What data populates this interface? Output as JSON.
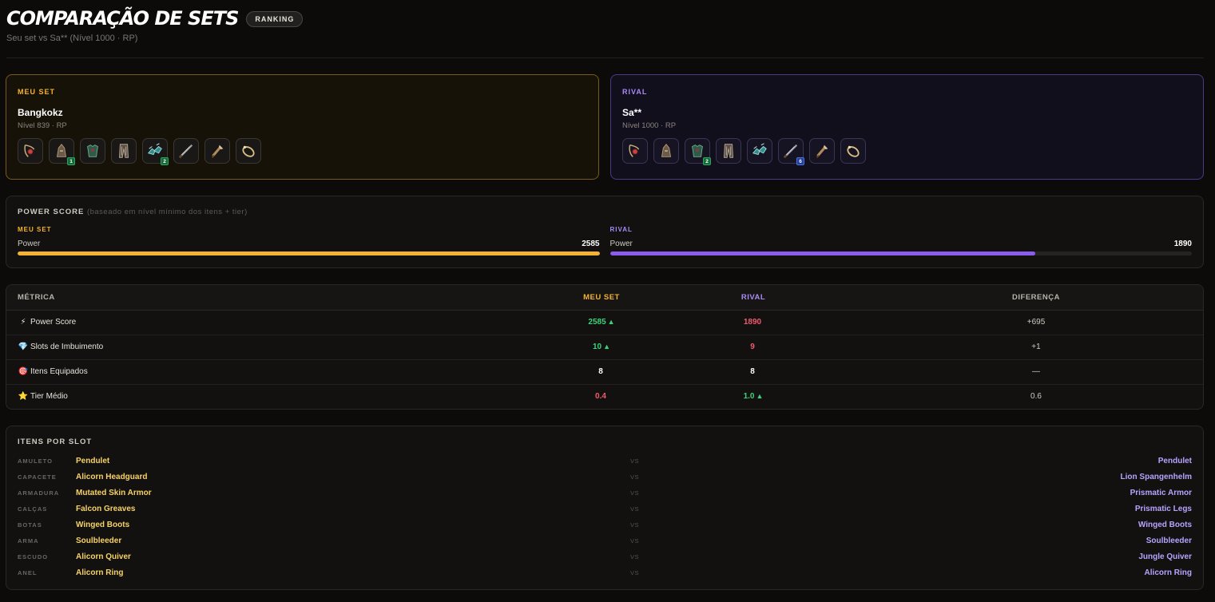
{
  "header": {
    "title": "COMPARAÇÃO DE SETS",
    "badge": "RANKING",
    "subtitle": "Seu set vs Sa** (Nível 1000 · RP)"
  },
  "mine": {
    "label": "MEU SET",
    "name": "Bangkokz",
    "level": "Nível 839 · RP",
    "slots": [
      {
        "icon": "amulet-icon",
        "badge": ""
      },
      {
        "icon": "helmet-icon",
        "badge": "1"
      },
      {
        "icon": "armor-icon",
        "badge": ""
      },
      {
        "icon": "legs-icon",
        "badge": ""
      },
      {
        "icon": "boots-icon",
        "badge": "2"
      },
      {
        "icon": "weapon-icon",
        "badge": ""
      },
      {
        "icon": "quiver-icon",
        "badge": ""
      },
      {
        "icon": "ring-icon",
        "badge": ""
      }
    ]
  },
  "rival": {
    "label": "RIVAL",
    "name": "Sa**",
    "level": "Nível 1000 · RP",
    "slots": [
      {
        "icon": "amulet-icon",
        "badge": ""
      },
      {
        "icon": "helmet-icon",
        "badge": ""
      },
      {
        "icon": "armor-icon",
        "badge": "2"
      },
      {
        "icon": "legs-icon",
        "badge": ""
      },
      {
        "icon": "boots-icon",
        "badge": ""
      },
      {
        "icon": "weapon-icon",
        "badge": "6"
      },
      {
        "icon": "quiver-icon",
        "badge": ""
      },
      {
        "icon": "ring-icon",
        "badge": ""
      }
    ]
  },
  "power": {
    "title": "POWER SCORE",
    "note": "(baseado em nível mínimo dos itens + tier)",
    "mine_label": "MEU SET",
    "rival_label": "RIVAL",
    "row_label": "Power",
    "mine_value": "2585",
    "rival_value": "1890",
    "mine_fraction": 1.0,
    "rival_fraction": 0.731
  },
  "table": {
    "headers": {
      "metric": "MÉTRICA",
      "mine": "MEU SET",
      "rival": "RIVAL",
      "diff": "DIFERENÇA"
    },
    "rows": [
      {
        "icon": "⚡",
        "metric": "Power Score",
        "mine": "2585",
        "mine_arrow": "▲",
        "rival": "1890",
        "rival_arrow": "",
        "diff": "+695"
      },
      {
        "icon": "💎",
        "metric": "Slots de Imbuimento",
        "mine": "10",
        "mine_arrow": "▲",
        "rival": "9",
        "rival_arrow": "",
        "diff": "+1"
      },
      {
        "icon": "🎯",
        "metric": "Itens Equipados",
        "mine": "8",
        "mine_arrow": "",
        "rival": "8",
        "rival_arrow": "",
        "diff": "—"
      },
      {
        "icon": "⭐",
        "metric": "Tier Médio",
        "mine": "0.4",
        "mine_arrow": "",
        "rival": "1.0",
        "rival_arrow": "▲",
        "diff": "0.6"
      }
    ]
  },
  "slots_section": {
    "title": "ITENS POR SLOT",
    "vs": "VS",
    "rows": [
      {
        "slot": "AMULETO",
        "mine": "Pendulet",
        "rival": "Pendulet"
      },
      {
        "slot": "CAPACETE",
        "mine": "Alicorn Headguard",
        "rival": "Lion Spangenhelm"
      },
      {
        "slot": "ARMADURA",
        "mine": "Mutated Skin Armor",
        "rival": "Prismatic Armor"
      },
      {
        "slot": "CALÇAS",
        "mine": "Falcon Greaves",
        "rival": "Prismatic Legs"
      },
      {
        "slot": "BOTAS",
        "mine": "Winged Boots",
        "rival": "Winged Boots"
      },
      {
        "slot": "ARMA",
        "mine": "Soulbleeder",
        "rival": "Soulbleeder"
      },
      {
        "slot": "ESCUDO",
        "mine": "Alicorn Quiver",
        "rival": "Jungle Quiver"
      },
      {
        "slot": "ANEL",
        "mine": "Alicorn Ring",
        "rival": "Alicorn Ring"
      }
    ]
  },
  "colors": {
    "accent_mine": "#f5b331",
    "accent_rival": "#a88bf5",
    "win": "#3bd37a",
    "lose": "#f05a6e"
  }
}
